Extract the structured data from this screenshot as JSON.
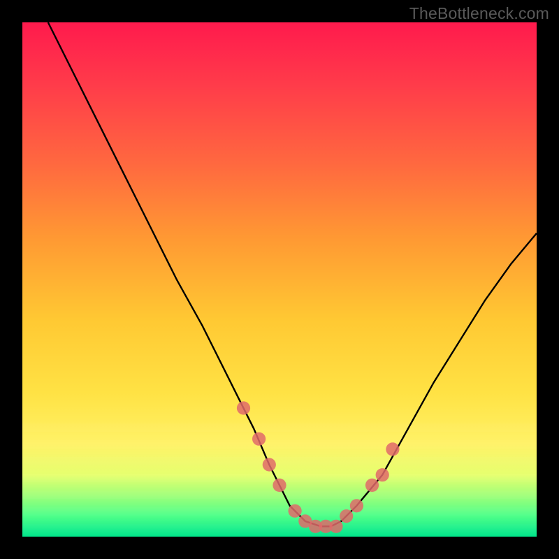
{
  "watermark": "TheBottleneck.com",
  "chart_data": {
    "type": "line",
    "title": "",
    "xlabel": "",
    "ylabel": "",
    "xlim": [
      0,
      100
    ],
    "ylim": [
      0,
      100
    ],
    "grid": false,
    "series": [
      {
        "name": "bottleneck-curve",
        "color": "#000000",
        "x": [
          5,
          10,
          15,
          20,
          25,
          30,
          35,
          40,
          42,
          45,
          48,
          50,
          52,
          55,
          58,
          60,
          62,
          65,
          70,
          75,
          80,
          85,
          90,
          95,
          100
        ],
        "values": [
          100,
          90,
          80,
          70,
          60,
          50,
          41,
          31,
          27,
          21,
          14,
          10,
          6,
          3,
          2,
          2,
          3,
          6,
          12,
          21,
          30,
          38,
          46,
          53,
          59
        ]
      }
    ],
    "markers": {
      "name": "curve-dots",
      "color": "#e06a6a",
      "radius_pct": 1.3,
      "x": [
        43,
        46,
        48,
        50,
        53,
        55,
        57,
        59,
        61,
        63,
        65,
        68,
        70,
        72
      ],
      "values": [
        25,
        19,
        14,
        10,
        5,
        3,
        2,
        2,
        2,
        4,
        6,
        10,
        12,
        17
      ]
    }
  }
}
